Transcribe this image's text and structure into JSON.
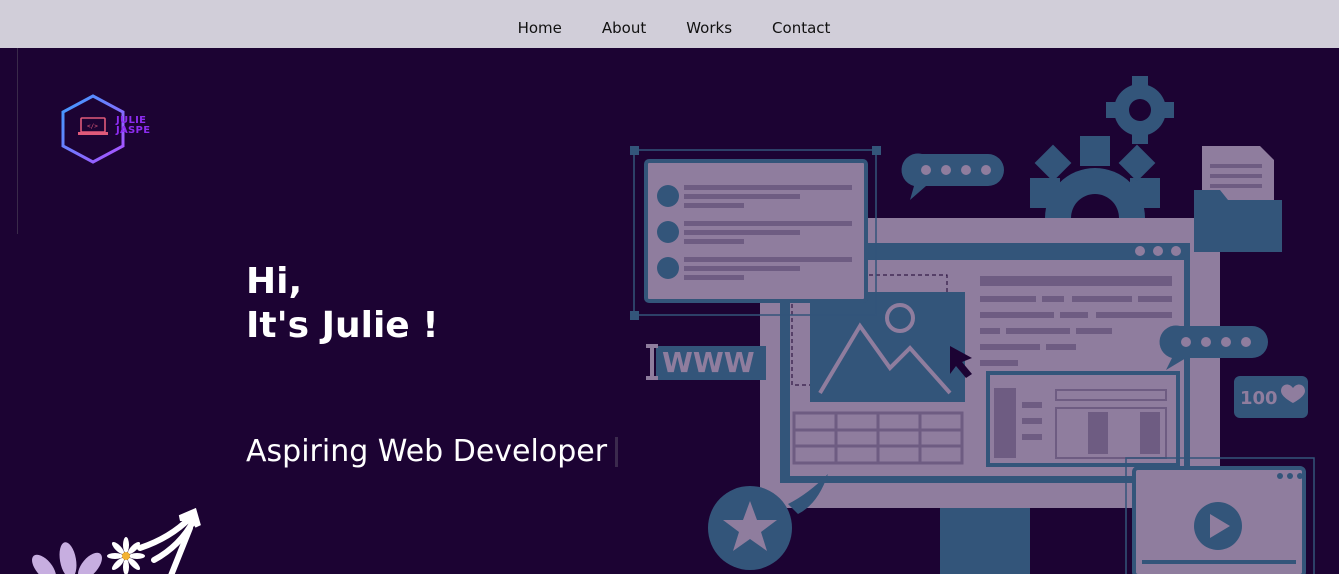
{
  "nav": {
    "links": [
      "Home",
      "About",
      "Works",
      "Contact"
    ]
  },
  "logo": {
    "line1": "JULIE",
    "line2": "JASPE"
  },
  "hero": {
    "greeting_line1": "Hi,",
    "greeting_line2": "It's Julie !",
    "subtitle": "Aspiring Web Developer"
  },
  "illustration": {
    "www_label": "WWW",
    "likes_count": "100"
  },
  "colors": {
    "nav_bg": "#d1ced9",
    "page_bg": "#1c0333",
    "accent_purple": "#8d2cf0",
    "illus_blue": "#33557a",
    "illus_lilac": "#8f7d9e"
  }
}
